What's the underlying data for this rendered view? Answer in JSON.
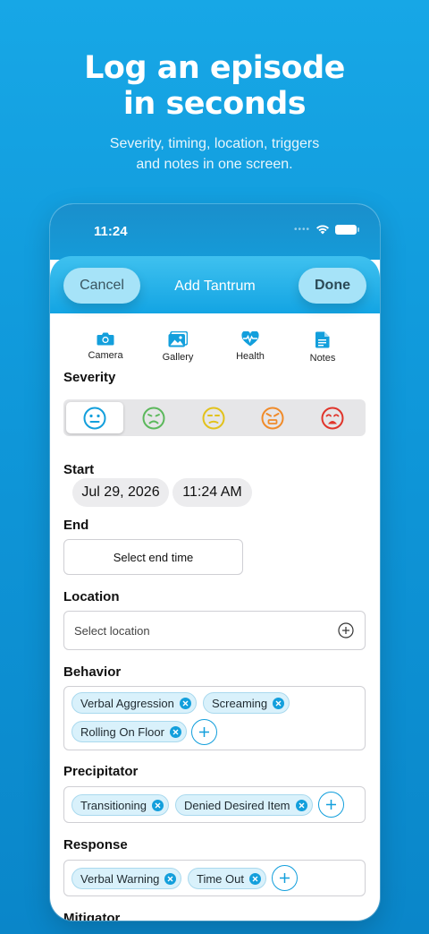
{
  "promo": {
    "headline_line1": "Log an episode",
    "headline_line2": "in seconds",
    "subline_line1": "Severity, timing, location, triggers",
    "subline_line2": "and notes in one screen."
  },
  "status_bar": {
    "time": "11:24"
  },
  "nav": {
    "cancel_label": "Cancel",
    "title": "Add Tantrum",
    "done_label": "Done"
  },
  "media": [
    {
      "label": "Camera",
      "icon": "camera-icon"
    },
    {
      "label": "Gallery",
      "icon": "gallery-icon"
    },
    {
      "label": "Health",
      "icon": "heart-pulse-icon"
    },
    {
      "label": "Notes",
      "icon": "document-icon"
    }
  ],
  "severity": {
    "label": "Severity",
    "options": [
      {
        "icon": "neutral-face-icon",
        "color": "#139fdc",
        "selected": true
      },
      {
        "icon": "frown-face-icon",
        "color": "#5cb85c"
      },
      {
        "icon": "annoyed-face-icon",
        "color": "#e2c21c"
      },
      {
        "icon": "angry-face-icon",
        "color": "#f08b2a"
      },
      {
        "icon": "crying-face-icon",
        "color": "#e0352b"
      }
    ]
  },
  "start": {
    "label": "Start",
    "date": "Jul 29, 2026",
    "time": "11:24 AM"
  },
  "end": {
    "label": "End",
    "placeholder": "Select end time"
  },
  "location": {
    "label": "Location",
    "placeholder": "Select location"
  },
  "behavior": {
    "label": "Behavior",
    "chips": [
      "Verbal Aggression",
      "Screaming",
      "Rolling On Floor"
    ]
  },
  "precipitator": {
    "label": "Precipitator",
    "chips": [
      "Transitioning",
      "Denied Desired Item"
    ]
  },
  "response": {
    "label": "Response",
    "chips": [
      "Verbal Warning",
      "Time Out"
    ]
  },
  "mitigator": {
    "label": "Mitigator"
  },
  "colors": {
    "accent": "#139fdc",
    "chip_bg": "#d9f1fb",
    "nav_button": "#a6e3f8"
  }
}
